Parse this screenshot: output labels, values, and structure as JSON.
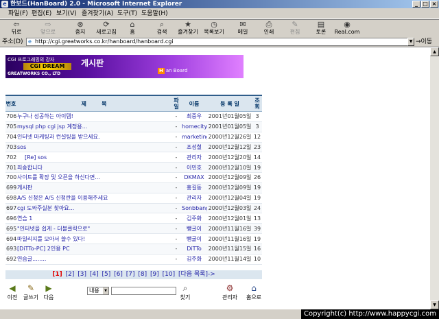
{
  "window": {
    "title": "한보드(HanBoard) 2.0 - Microsoft Internet Explorer",
    "app_icon": "ie-icon",
    "controls": [
      "_",
      "□",
      "×"
    ]
  },
  "menu": [
    "파일(F)",
    "편집(E)",
    "보기(V)",
    "즐겨찾기(A)",
    "도구(T)",
    "도움말(H)"
  ],
  "toolbar": [
    {
      "label": "뒤로",
      "icon": "back-arrow-icon",
      "glyph": "⇦",
      "enabled": true
    },
    {
      "label": "앞으로",
      "icon": "forward-arrow-icon",
      "glyph": "⇨",
      "enabled": false
    },
    {
      "label": "중지",
      "icon": "stop-icon",
      "glyph": "⊗",
      "enabled": true
    },
    {
      "label": "새로고침",
      "icon": "refresh-icon",
      "glyph": "⟳",
      "enabled": true
    },
    {
      "label": "홈",
      "icon": "home-icon",
      "glyph": "⌂",
      "enabled": true
    },
    {
      "label": "검색",
      "icon": "search-icon",
      "glyph": "⌕",
      "enabled": true
    },
    {
      "label": "즐겨찾기",
      "icon": "favorites-icon",
      "glyph": "★",
      "enabled": true
    },
    {
      "label": "목록보기",
      "icon": "history-icon",
      "glyph": "◷",
      "enabled": true
    },
    {
      "label": "메일",
      "icon": "mail-icon",
      "glyph": "✉",
      "enabled": true
    },
    {
      "label": "인쇄",
      "icon": "print-icon",
      "glyph": "⎙",
      "enabled": true
    },
    {
      "label": "편집",
      "icon": "edit-icon",
      "glyph": "✎",
      "enabled": false
    },
    {
      "label": "토론",
      "icon": "discuss-icon",
      "glyph": "▤",
      "enabled": true
    },
    {
      "label": "Real.com",
      "icon": "realcom-icon",
      "glyph": "◉",
      "enabled": true
    }
  ],
  "address": {
    "label": "주소(D)",
    "url": "http://cgi.greatworks.co.kr/hanboard/hanboard.cgi",
    "go_label": "이동"
  },
  "banner": {
    "line1": "CGI 프로그래밍의 강자",
    "line2": "CGI DREAM",
    "line3": "GREATWORKS CO., LTD",
    "title": "게시판",
    "logo_letter": "H",
    "logo_text": "an Board"
  },
  "board": {
    "columns": {
      "num": "번호",
      "subject": "제        목",
      "file": "파일",
      "name": "이름",
      "date": "등 록 일",
      "hits": "조회"
    },
    "rows": [
      {
        "num": "706",
        "subject": "누구나 성공하는 아이템!",
        "file": "-",
        "name": "최중우",
        "date": "2001년01월05일",
        "hits": "3"
      },
      {
        "num": "705",
        "subject": "mysql php cgi jsp 계정용...",
        "file": "-",
        "name": "homecity",
        "date": "2001년01월05일",
        "hits": "3"
      },
      {
        "num": "704",
        "subject": "인터넷 마케팅과 컨설팅을 받으세요.",
        "file": "-",
        "name": "marketing",
        "date": "2000년12월26일",
        "hits": "12"
      },
      {
        "num": "703",
        "subject": "sos",
        "file": "-",
        "name": "조성철",
        "date": "2000년12월12일",
        "hits": "23"
      },
      {
        "num": "702",
        "subject": "[Re] sos",
        "indent": true,
        "file": "-",
        "name": "관리자",
        "date": "2000년12월20일",
        "hits": "14"
      },
      {
        "num": "701",
        "subject": "죄송합니다",
        "file": "-",
        "name": "이민호",
        "date": "2000년12월10일",
        "hits": "19"
      },
      {
        "num": "700",
        "subject": "사이트를 확장 및 오픈을 하신다면...",
        "file": "-",
        "name": "DKMAX",
        "date": "2000년12월09일",
        "hits": "26"
      },
      {
        "num": "699",
        "subject": "게시판",
        "file": "-",
        "name": "홍길동",
        "date": "2000년12월09일",
        "hits": "19"
      },
      {
        "num": "698",
        "subject": "A/S 신청은 A/S 신청란을 이용해주세요",
        "file": "-",
        "name": "관리자",
        "date": "2000년12월04일",
        "hits": "19"
      },
      {
        "num": "697",
        "subject": "cgi 도와주실분 찾아요...",
        "file": "-",
        "name": "Sonbbang",
        "date": "2000년12월03일",
        "hits": "24"
      },
      {
        "num": "696",
        "subject": "연습 1",
        "file": "-",
        "name": "김주화",
        "date": "2000년12월01일",
        "hits": "13"
      },
      {
        "num": "695",
        "subject": "\"인터넷을 쉽게 - 더블클릭으로\"",
        "file": "-",
        "name": "뺑굴이",
        "date": "2000년11월16일",
        "hits": "39"
      },
      {
        "num": "694",
        "subject": "마일리지를 모아서 쓸수 있다!",
        "file": "-",
        "name": "뺑굴이",
        "date": "2000년11월16일",
        "hits": "19"
      },
      {
        "num": "693",
        "subject": "[DiTTo-PC] 2인용 PC",
        "file": "-",
        "name": "DiTTo",
        "date": "2000년11월15일",
        "hits": "16"
      },
      {
        "num": "692",
        "subject": "연습글........",
        "file": "-",
        "name": "김주화",
        "date": "2000년11월14일",
        "hits": "10"
      }
    ]
  },
  "pagination": {
    "current": "[1]",
    "pages": [
      "[2]",
      "[3]",
      "[4]",
      "[5]",
      "[6]",
      "[7]",
      "[8]",
      "[9]",
      "[10]"
    ],
    "next": "[다음 목록]->"
  },
  "bottom": {
    "prev_label": "이전",
    "write_label": "글쓰기",
    "next_label": "다음",
    "search_select": "내용",
    "search_label": "찾기",
    "admin_label": "관리자",
    "home_label": "홈으로"
  },
  "copyright": "Copyright(c) http://www.happycgi.com"
}
